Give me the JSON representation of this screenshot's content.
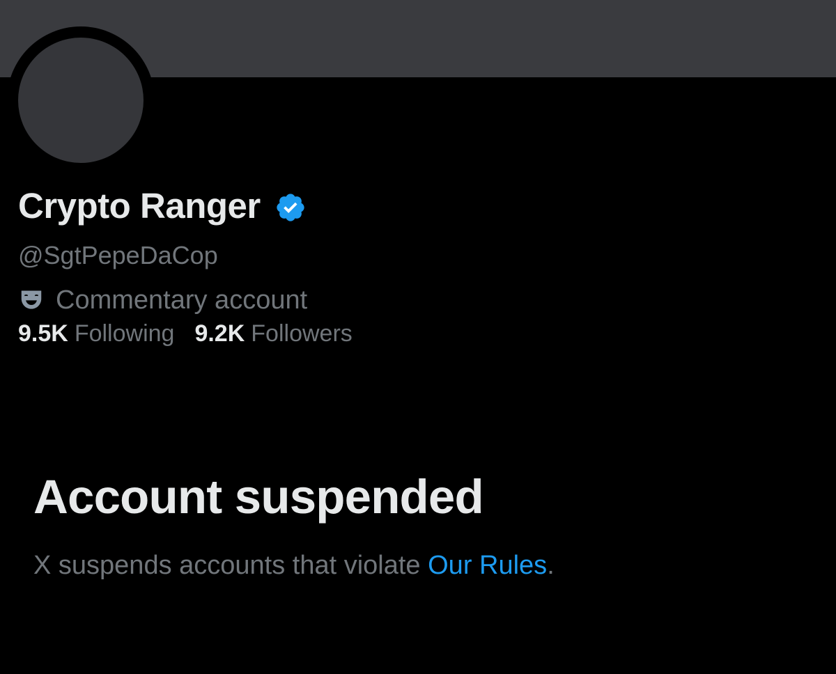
{
  "profile": {
    "display_name": "Crypto Ranger",
    "handle": "@SgtPepeDaCop",
    "verified_icon": "verified-badge-icon",
    "account_label": "Commentary account",
    "account_label_icon": "theater-mask-icon",
    "following_count": "9.5K",
    "following_label": "Following",
    "followers_count": "9.2K",
    "followers_label": "Followers"
  },
  "suspension": {
    "title": "Account suspended",
    "message_prefix": "X suspends accounts that violate ",
    "rules_link_text": "Our Rules",
    "message_suffix": "."
  },
  "colors": {
    "background": "#000000",
    "banner": "#3a3b3f",
    "avatar_placeholder": "#35363a",
    "primary_text": "#e7e9ea",
    "secondary_text": "#71767b",
    "link": "#1d9bf0",
    "verified_badge": "#1d9bf0"
  }
}
